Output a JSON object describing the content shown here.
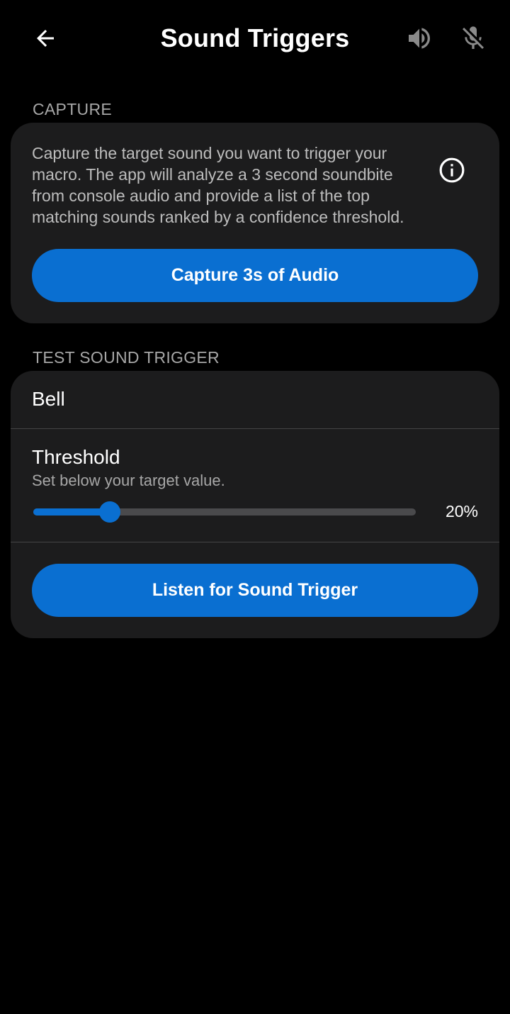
{
  "header": {
    "title": "Sound Triggers",
    "back_icon": "arrow-left-icon",
    "speaker_icon": "speaker-volume-icon",
    "mic_icon": "microphone-off-icon"
  },
  "capture": {
    "section_label": "CAPTURE",
    "description": "Capture the target sound you want to trigger your macro. The app will analyze a 3 second soundbite from console audio and provide a list of the top matching sounds ranked by a confidence threshold.",
    "info_icon": "info-icon",
    "button_label": "Capture 3s of Audio"
  },
  "test": {
    "section_label": "TEST SOUND TRIGGER",
    "sound_name": "Bell",
    "threshold_title": "Threshold",
    "threshold_subtitle": "Set below your target value.",
    "threshold_value_label": "20%",
    "threshold_fraction": 0.2,
    "button_label": "Listen for Sound Trigger"
  },
  "colors": {
    "accent": "#0a6fd1",
    "card": "#1c1c1d",
    "background": "#000000",
    "secondary_text": "#a7a7a7"
  }
}
